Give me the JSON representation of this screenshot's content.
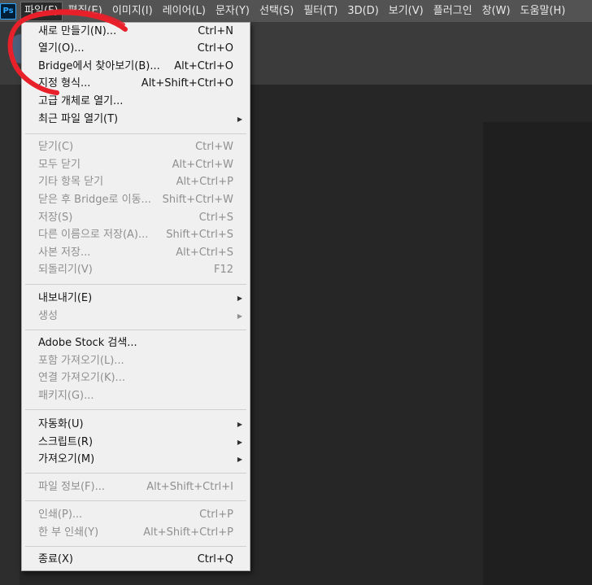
{
  "app": {
    "logo": "Ps"
  },
  "menubar": {
    "items": [
      "파일(F)",
      "편집(E)",
      "이미지(I)",
      "레이어(L)",
      "문자(Y)",
      "선택(S)",
      "필터(T)",
      "3D(D)",
      "보기(V)",
      "플러그인",
      "창(W)",
      "도움말(H)"
    ]
  },
  "file_menu": {
    "items": [
      {
        "label": "새로 만들기(N)...",
        "shortcut": "Ctrl+N"
      },
      {
        "label": "열기(O)...",
        "shortcut": "Ctrl+O"
      },
      {
        "label": "Bridge에서 찾아보기(B)...",
        "shortcut": "Alt+Ctrl+O"
      },
      {
        "label": "지정 형식...",
        "shortcut": "Alt+Shift+Ctrl+O"
      },
      {
        "label": "고급 개체로 열기...",
        "shortcut": ""
      },
      {
        "label": "최근 파일 열기(T)",
        "shortcut": ""
      },
      {
        "label": "닫기(C)",
        "shortcut": "Ctrl+W"
      },
      {
        "label": "모두 닫기",
        "shortcut": "Alt+Ctrl+W"
      },
      {
        "label": "기타 항목 닫기",
        "shortcut": "Alt+Ctrl+P"
      },
      {
        "label": "닫은 후 Bridge로 이동...",
        "shortcut": "Shift+Ctrl+W"
      },
      {
        "label": "저장(S)",
        "shortcut": "Ctrl+S"
      },
      {
        "label": "다른 이름으로 저장(A)...",
        "shortcut": "Shift+Ctrl+S"
      },
      {
        "label": "사본 저장...",
        "shortcut": "Alt+Ctrl+S"
      },
      {
        "label": "되돌리기(V)",
        "shortcut": "F12"
      },
      {
        "label": "내보내기(E)",
        "shortcut": ""
      },
      {
        "label": "생성",
        "shortcut": ""
      },
      {
        "label": "Adobe Stock 검색...",
        "shortcut": ""
      },
      {
        "label": "포함 가져오기(L)...",
        "shortcut": ""
      },
      {
        "label": "연결 가져오기(K)...",
        "shortcut": ""
      },
      {
        "label": "패키지(G)...",
        "shortcut": ""
      },
      {
        "label": "자동화(U)",
        "shortcut": ""
      },
      {
        "label": "스크립트(R)",
        "shortcut": ""
      },
      {
        "label": "가져오기(M)",
        "shortcut": ""
      },
      {
        "label": "파일 정보(F)...",
        "shortcut": "Alt+Shift+Ctrl+I"
      },
      {
        "label": "인쇄(P)...",
        "shortcut": "Ctrl+P"
      },
      {
        "label": "한 부 인쇄(Y)",
        "shortcut": "Alt+Shift+Ctrl+P"
      },
      {
        "label": "종료(X)",
        "shortcut": "Ctrl+Q"
      }
    ]
  },
  "colors": {
    "annotation": "#e8202a",
    "menu_bg": "#f0f0f0",
    "disabled_text": "#8f8f8f"
  }
}
